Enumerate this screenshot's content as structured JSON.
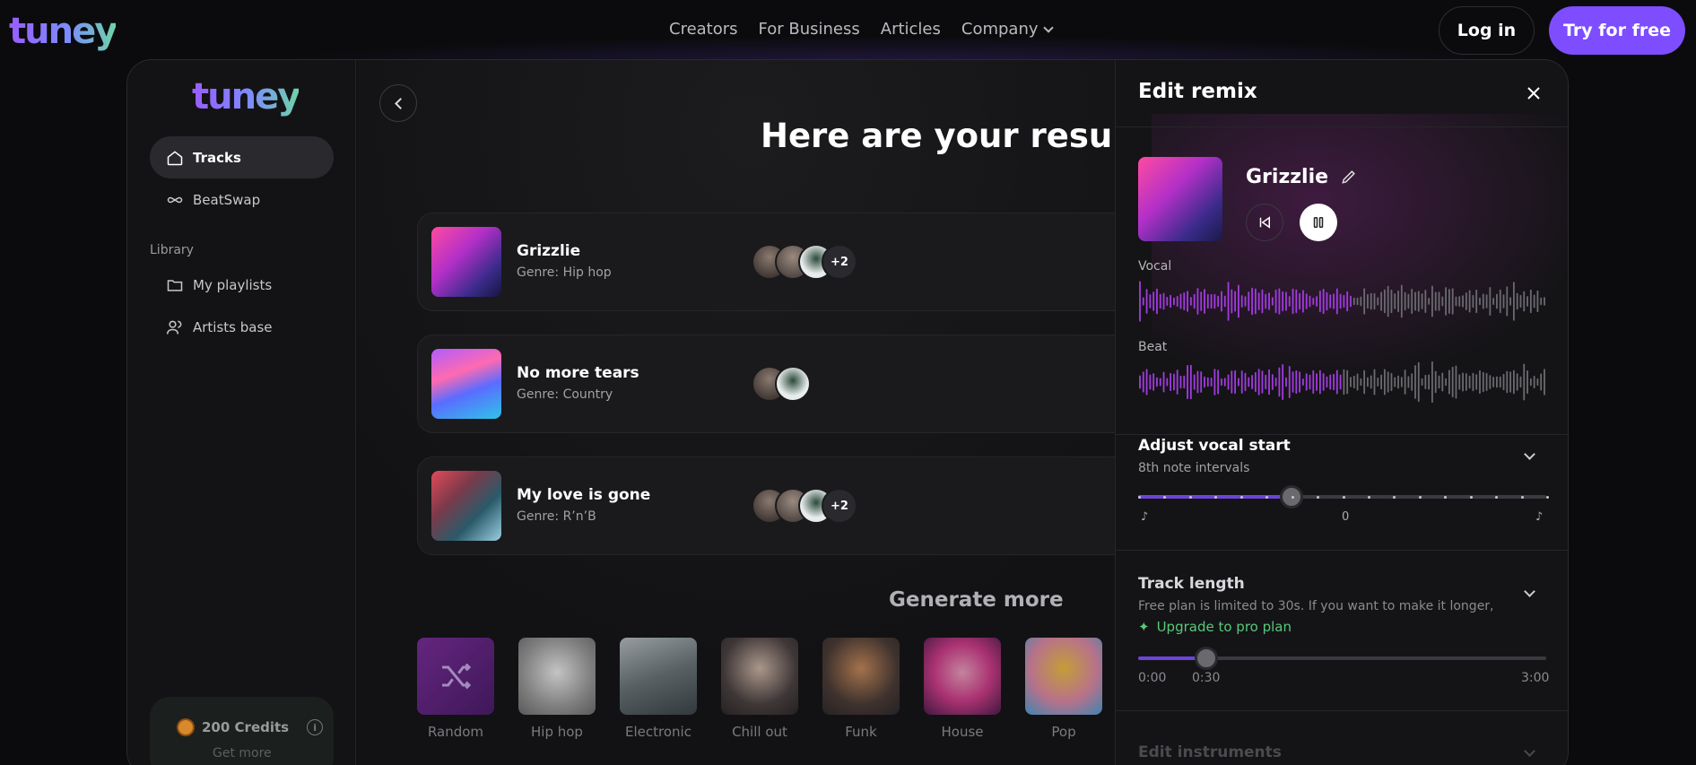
{
  "nav": {
    "logo": "tuney",
    "links": [
      "Creators",
      "For Business",
      "Articles",
      "Company"
    ],
    "login": "Log in",
    "try_free": "Try for free"
  },
  "sidebar": {
    "logo": "tuney",
    "items": [
      {
        "label": "Tracks",
        "icon": "home-icon",
        "active": true
      },
      {
        "label": "BeatSwap",
        "icon": "infinity-icon",
        "active": false
      }
    ],
    "library_label": "Library",
    "library_items": [
      {
        "label": "My playlists",
        "icon": "folder-icon"
      },
      {
        "label": "Artists base",
        "icon": "users-icon"
      }
    ],
    "credits": "200 Credits",
    "get_more": "Get more"
  },
  "main": {
    "title": "Here are your results",
    "tracks": [
      {
        "name": "Grizzlie",
        "genre": "Genre: Hip hop",
        "extra": "+2"
      },
      {
        "name": "No more tears",
        "genre": "Genre: Country",
        "extra": ""
      },
      {
        "name": "My love is gone",
        "genre": "Genre: R’n’B",
        "extra": "+2"
      }
    ],
    "generate_more": "Generate more",
    "genres": [
      "Random",
      "Hip hop",
      "Electronic",
      "Chill out",
      "Funk",
      "House",
      "Pop"
    ]
  },
  "panel": {
    "title": "Edit remix",
    "track_name": "Grizzlie",
    "vocal_label": "Vocal",
    "beat_label": "Beat",
    "vocal_start": {
      "title": "Adjust vocal start",
      "subtitle": "8th note intervals",
      "value_label": "0",
      "position": 0.375
    },
    "track_length": {
      "title": "Track length",
      "note": "Free plan is limited to 30s. If you want to make it longer,",
      "upgrade": "Upgrade to pro plan",
      "start": "0:00",
      "current": "0:30",
      "end": "3:00",
      "position": 0.1667
    },
    "edit_instruments": "Edit instruments"
  },
  "colors": {
    "accent": "#7d4dff",
    "wave_active": "#a23be0",
    "wave_inactive": "#6a6a70",
    "upgrade": "#58c97a"
  }
}
